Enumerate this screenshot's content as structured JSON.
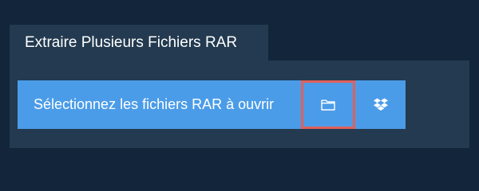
{
  "tab": {
    "label": "Extraire Plusieurs Fichiers RAR"
  },
  "actions": {
    "select_label": "Sélectionnez les fichiers RAR à ouvrir",
    "folder_icon": "folder-icon",
    "dropbox_icon": "dropbox-icon"
  },
  "colors": {
    "background": "#13253a",
    "panel": "#233a50",
    "button": "#4b9ce8",
    "highlight_border": "#e0605b"
  }
}
